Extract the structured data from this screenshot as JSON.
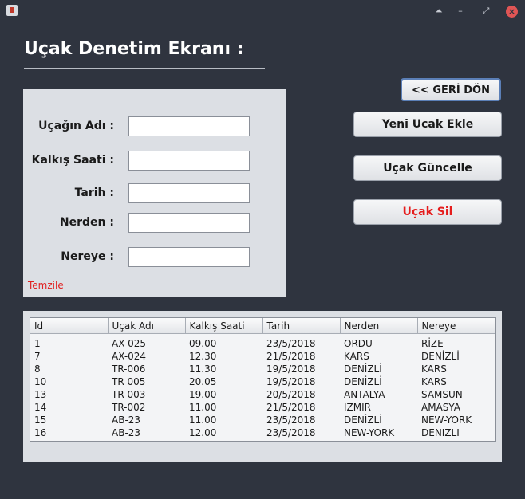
{
  "window": {
    "controls": {
      "minimize_up": "⏶",
      "minimize": "–",
      "maximize": "⤢",
      "close": "×"
    }
  },
  "heading": "Uçak Denetim Ekranı :",
  "form": {
    "fields": [
      {
        "label": "Uçağın Adı :",
        "value": ""
      },
      {
        "label": "Kalkış Saati :",
        "value": ""
      },
      {
        "label": "Tarih :",
        "value": ""
      },
      {
        "label": "Nerden :",
        "value": ""
      },
      {
        "label": "Nereye :",
        "value": ""
      }
    ],
    "clear_link": "Temzile"
  },
  "buttons": {
    "back": "<< GERİ DÖN",
    "add": "Yeni Ucak Ekle",
    "update": "Uçak Güncelle",
    "delete": "Uçak Sil"
  },
  "table": {
    "columns": [
      "Id",
      "Uçak Adı",
      "Kalkış Saati",
      "Tarih",
      "Nerden",
      "Nereye"
    ],
    "rows": [
      [
        "1",
        "AX-025",
        "09.00",
        "23/5/2018",
        "ORDU",
        "RİZE"
      ],
      [
        "7",
        "AX-024",
        "12.30",
        "21/5/2018",
        "KARS",
        "DENİZLİ"
      ],
      [
        "8",
        "TR-006",
        "11.30",
        "19/5/2018",
        "DENİZLİ",
        "KARS"
      ],
      [
        "10",
        "TR 005",
        "20.05",
        "19/5/2018",
        "DENİZLİ",
        "KARS"
      ],
      [
        "13",
        "TR-003",
        "19.00",
        "20/5/2018",
        "ANTALYA",
        "SAMSUN"
      ],
      [
        "14",
        "TR-002",
        "11.00",
        "21/5/2018",
        "IZMIR",
        "AMASYA"
      ],
      [
        "15",
        "AB-23",
        "11.00",
        "23/5/2018",
        "DENİZLİ",
        "NEW-YORK"
      ],
      [
        "16",
        "AB-23",
        "12.00",
        "23/5/2018",
        "NEW-YORK",
        "DENIZLI"
      ]
    ]
  },
  "colors": {
    "window_bg": "#2f343f",
    "panel_bg": "#dcdfe4",
    "delete_text": "#e51d1d",
    "clear_link": "#e02020",
    "back_border": "#5b7fb7"
  }
}
